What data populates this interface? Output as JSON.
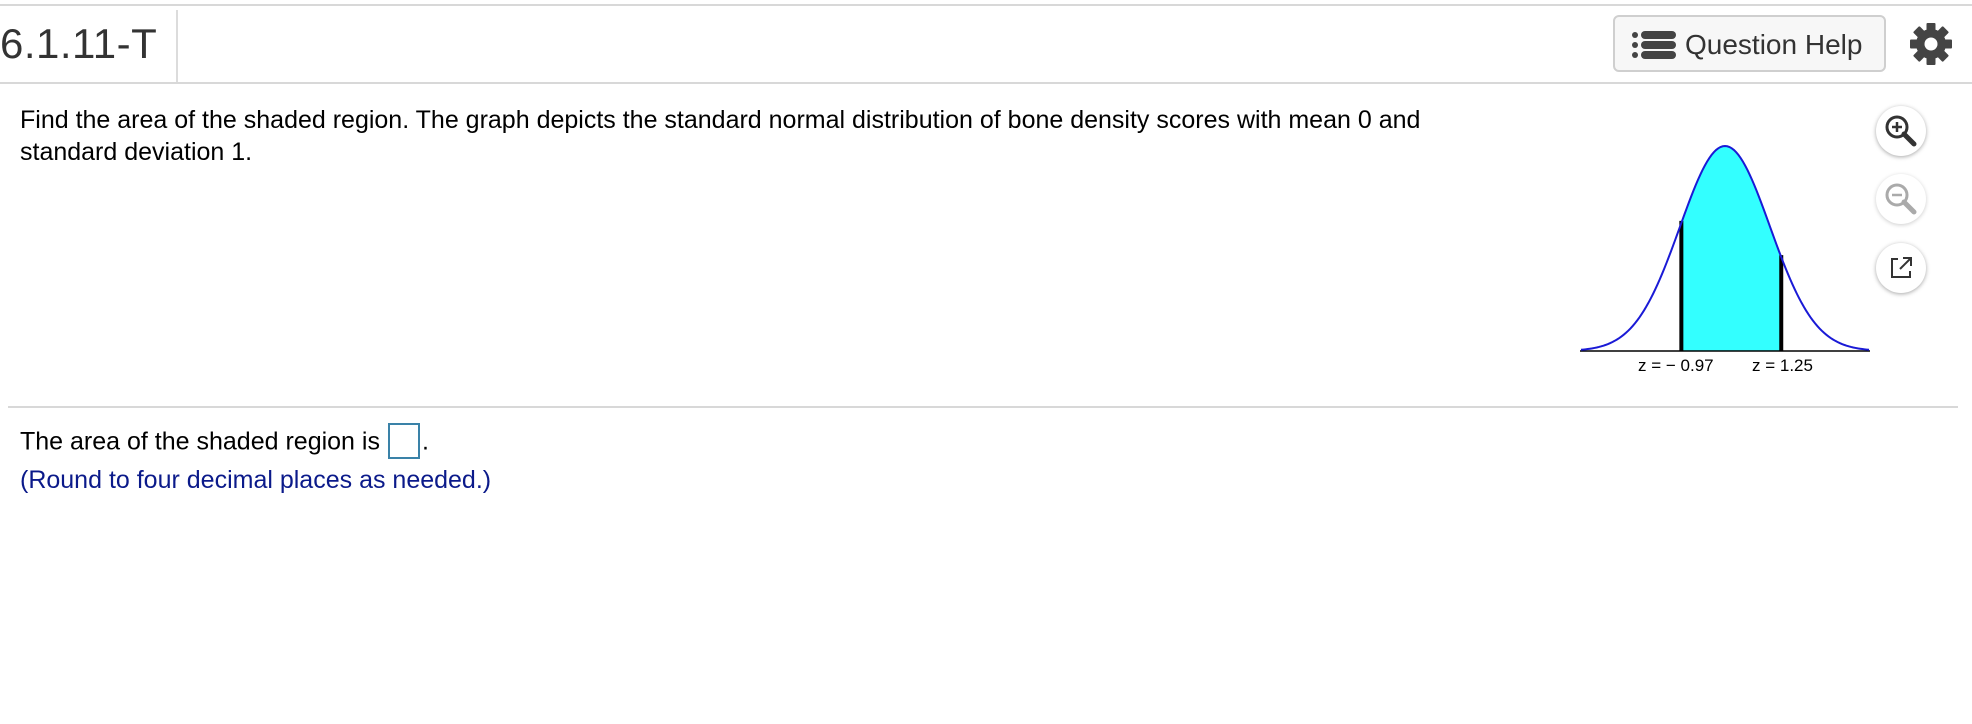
{
  "header": {
    "question_id": "6.1.11-T",
    "help_button_label": "Question Help"
  },
  "question": {
    "text": "Find the area of the shaded region. The graph depicts the standard normal distribution of bone density scores with mean 0 and standard deviation 1."
  },
  "graph": {
    "z_left_label": "z = − 0.97",
    "z_right_label": "z = 1.25",
    "z_left": -0.97,
    "z_right": 1.25,
    "fill_color": "#33ffff",
    "curve_color": "#1a1ad6"
  },
  "answer": {
    "prefix": "The area of the shaded region is",
    "suffix": ".",
    "value": "",
    "hint": "(Round to four decimal places as needed.)"
  },
  "colors": {
    "hint_text": "#0b1a8a",
    "input_border": "#3a82a8"
  }
}
